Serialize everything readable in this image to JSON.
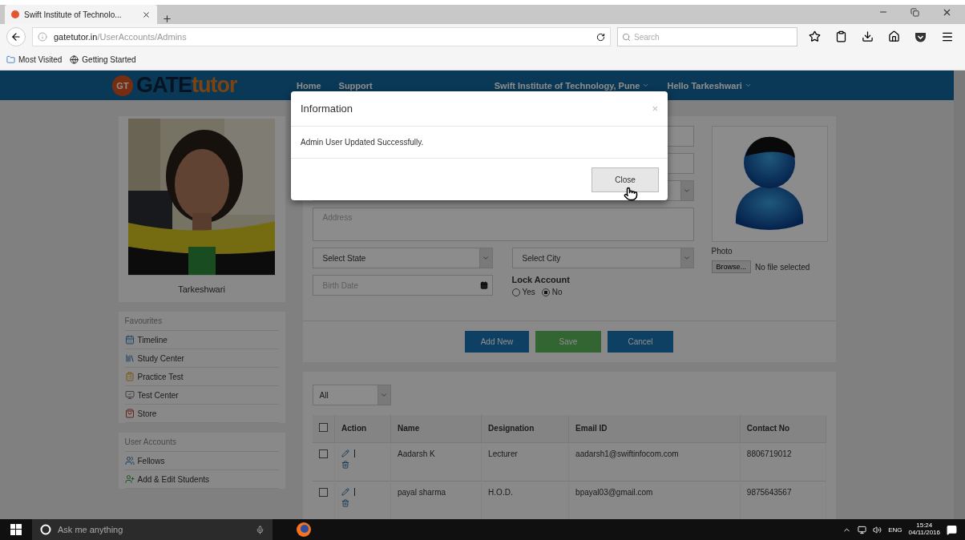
{
  "browser": {
    "tab_title": "Swift Institute of Technolo...",
    "url_domain": "gatetutor.in",
    "url_path": "/UserAccounts/Admins",
    "search_placeholder": "Search",
    "bookmarks": [
      "Most Visited",
      "Getting Started"
    ]
  },
  "header": {
    "logo_mark": "GT",
    "logo_first": "GATE",
    "logo_second": "tutor",
    "nav": [
      "Home",
      "Support"
    ],
    "menus": [
      "Swift Institute of Technology, Pune",
      "Hello Tarkeshwari"
    ]
  },
  "profile": {
    "kind": "picture",
    "name": "Tarkeshwari"
  },
  "sidebar": [
    {
      "title": "Favourites",
      "items": [
        "Timeline",
        "Study Center",
        "Practice Test",
        "Test Center",
        "Store"
      ]
    },
    {
      "title": "User Accounts",
      "items": [
        "Fellows",
        "Add & Edit Students"
      ]
    }
  ],
  "form": {
    "address_placeholder": "Address",
    "state_select": "Select State",
    "city_select": "Select City",
    "birth_date_placeholder": "Birth Date",
    "lock_label": "Lock Account",
    "lock_options": [
      {
        "label": "Yes",
        "selected": false
      },
      {
        "label": "No",
        "selected": true
      }
    ],
    "photo_label": "Photo",
    "browse_label": "Browse...",
    "file_status": "No file selected",
    "buttons": [
      {
        "label": "Add New",
        "kind": "primary"
      },
      {
        "label": "Save",
        "kind": "success"
      },
      {
        "label": "Cancel",
        "kind": "primary"
      }
    ]
  },
  "table": {
    "filter": "All",
    "all_checked": false,
    "columns": [
      "Action",
      "Name",
      "Designation",
      "Email ID",
      "Contact No"
    ],
    "rows": [
      {
        "checked": false,
        "name": "Aadarsh K",
        "designation": "Lecturer",
        "email": "aadarsh1@swiftinfocom.com",
        "contact": "8806719012"
      },
      {
        "checked": false,
        "name": "payal sharma",
        "designation": "H.O.D.",
        "email": "bpayal03@gmail.com",
        "contact": "9875643567"
      }
    ]
  },
  "modal": {
    "title": "Information",
    "close_symbol": "×",
    "message": "Admin User Updated Successfully.",
    "button": "Close"
  },
  "taskbar": {
    "search_placeholder": "Ask me anything",
    "language": "ENG",
    "time": "15:24",
    "date": "04/11/2016"
  }
}
